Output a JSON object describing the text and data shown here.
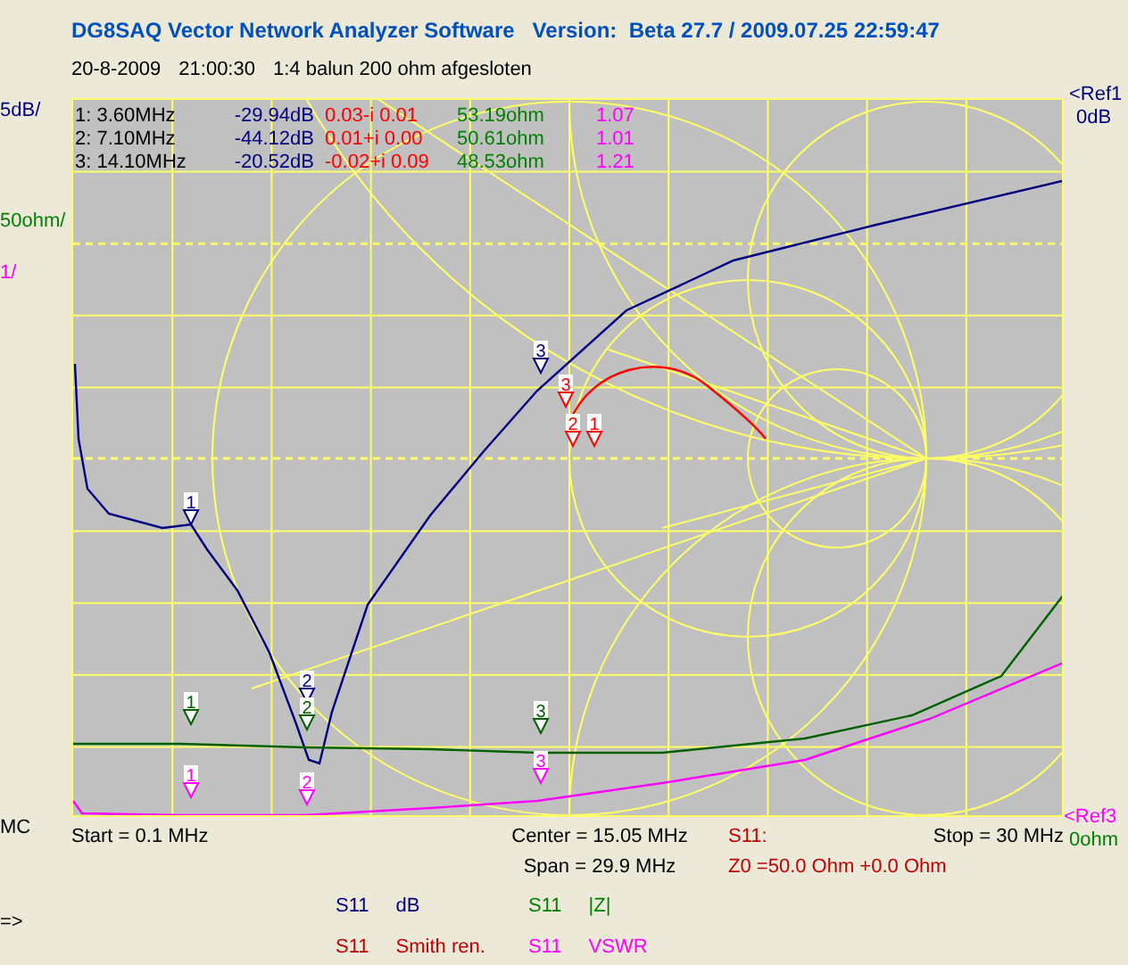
{
  "header": {
    "title": "DG8SAQ Vector Network Analyzer Software   Version:  Beta 27.7 / 2009.07.25 22:59:47",
    "date": "20-8-2009",
    "time": "21:00:30",
    "note": "1:4 balun 200 ohm afgesloten"
  },
  "scale_labels": [
    {
      "text": "5dB/",
      "color": "#000080"
    },
    {
      "text": "50ohm/",
      "color": "#008000"
    },
    {
      "text": "1/",
      "color": "#ff00ff"
    }
  ],
  "mode": "MC",
  "ref_top": [
    {
      "text": "<Ref1",
      "color": "#000080"
    },
    {
      "text": "0dB",
      "color": "#000080"
    }
  ],
  "ref_bottom": [
    {
      "text": "<Ref3",
      "color": "#ff00ff"
    },
    {
      "text": "0ohm",
      "color": "#008000"
    }
  ],
  "marker_table": [
    {
      "index": "1:",
      "freq": "3.60MHz",
      "db": "-29.94dB",
      "smith": "0.03-i 0.01",
      "z": "53.19ohm",
      "vswr": "1.07"
    },
    {
      "index": "2:",
      "freq": "7.10MHz",
      "db": "-44.12dB",
      "smith": "0.01+i 0.00",
      "z": "50.61ohm",
      "vswr": "1.01"
    },
    {
      "index": "3:",
      "freq": "14.10MHz",
      "db": "-20.52dB",
      "smith": "-0.02+i 0.09",
      "z": "48.53ohm",
      "vswr": "1.21"
    }
  ],
  "traces": [
    {
      "kind": "db",
      "color": "#000080",
      "markers": [
        "1",
        "2",
        "3"
      ]
    },
    {
      "kind": "z",
      "color": "#006000",
      "markers": [
        "1",
        "2",
        "3"
      ]
    },
    {
      "kind": "vswr",
      "color": "#ff00ff",
      "markers": [
        "1",
        "2",
        "3"
      ]
    },
    {
      "kind": "smith",
      "color": "#ff0000",
      "markers": [
        "3",
        "2",
        "1"
      ]
    }
  ],
  "sweep": {
    "start": "Start = 0.1 MHz",
    "center": "Center = 15.05 MHz",
    "span": "Span = 29.9 MHz",
    "stop": "Stop = 30 MHz"
  },
  "impedance": {
    "label": "S11:",
    "z0": "Z0 =",
    "real": "50.0 Ohm +",
    "imag": "0.0 Ohm"
  },
  "prompt": "=>",
  "legend": [
    {
      "param": "S11",
      "trace": "dB",
      "color": "#000080"
    },
    {
      "param": "S11",
      "trace": "|Z|",
      "color": "#008000"
    },
    {
      "param": "S11",
      "trace": "Smith ren.",
      "color": "#c00000"
    },
    {
      "param": "S11",
      "trace": "VSWR",
      "color": "#ff00ff"
    }
  ]
}
